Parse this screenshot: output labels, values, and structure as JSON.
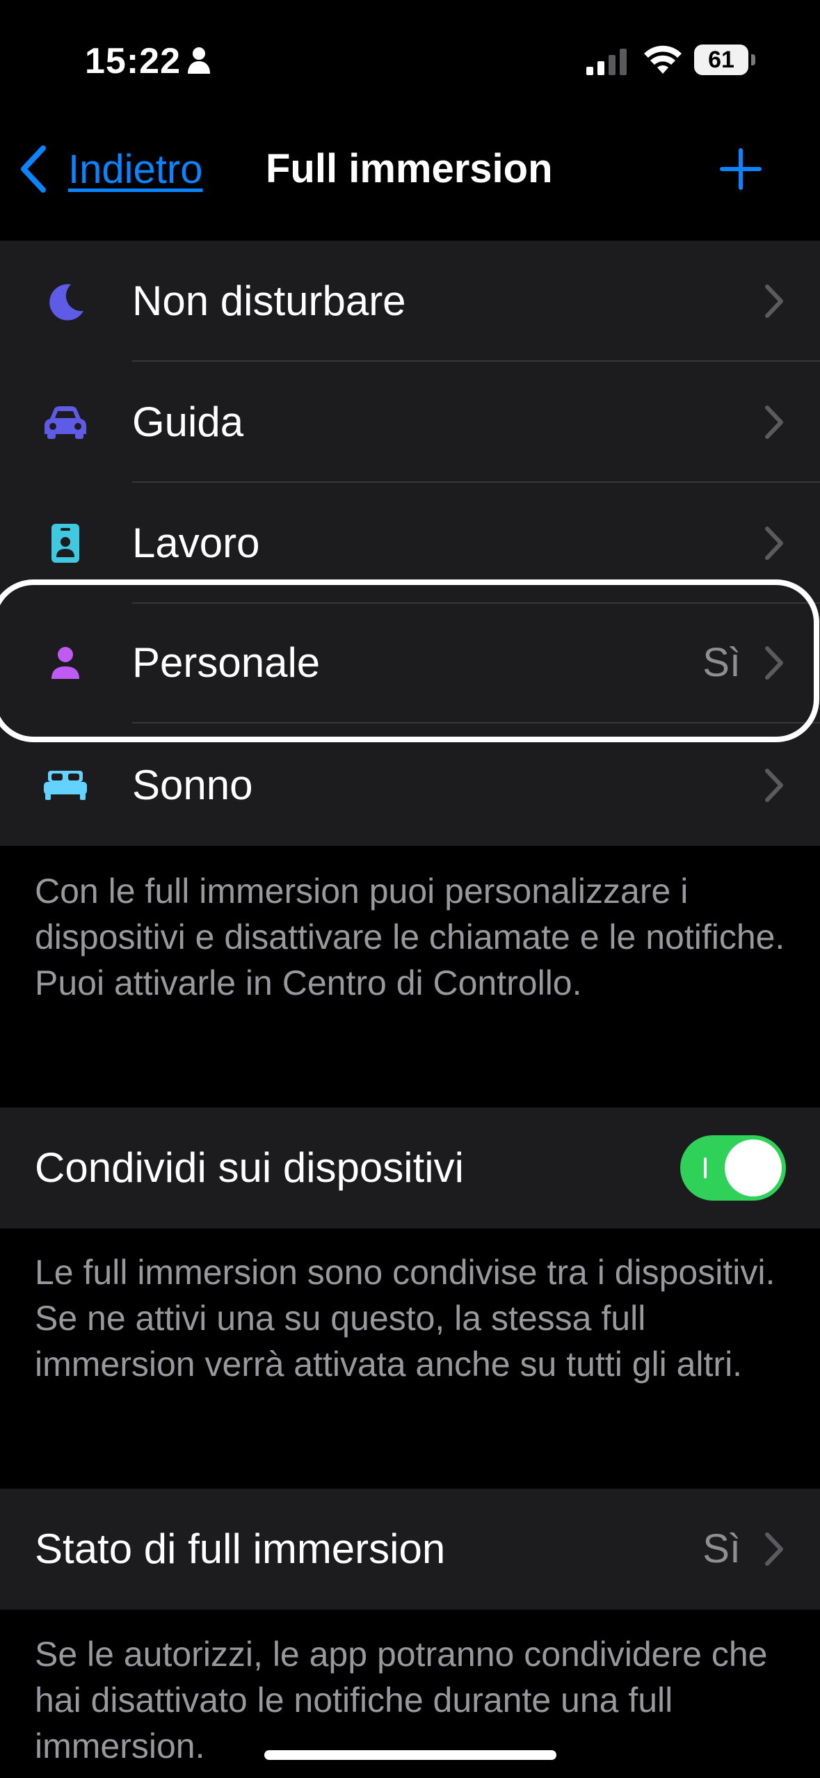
{
  "status_bar": {
    "time": "15:22",
    "battery": "61"
  },
  "nav": {
    "back_label": "Indietro",
    "title": "Full immersion"
  },
  "focus_modes": [
    {
      "label": "Non disturbare",
      "icon": "moon-icon",
      "color": "#5e5ce6",
      "value": ""
    },
    {
      "label": "Guida",
      "icon": "car-icon",
      "color": "#5e5ce6",
      "value": ""
    },
    {
      "label": "Lavoro",
      "icon": "id-badge-icon",
      "color": "#40c8e0",
      "value": ""
    },
    {
      "label": "Personale",
      "icon": "person-icon",
      "color": "#bf5af2",
      "value": "Sì"
    },
    {
      "label": "Sonno",
      "icon": "bed-icon",
      "color": "#64d2ff",
      "value": ""
    }
  ],
  "notes": {
    "focus_info": "Con le full immersion puoi personalizzare i dispositivi e disattivare le chiamate e le notifiche. Puoi attivarle in Centro di Controllo.",
    "share_info": "Le full immersion sono condivise tra i dispositivi. Se ne attivi una su questo, la stessa full immersion verrà attivata anche su tutti gli altri.",
    "status_info": "Se le autorizzi, le app potranno condividere che hai disattivato le notifiche durante una full immersion."
  },
  "share_across_devices": {
    "label": "Condividi sui dispositivi",
    "enabled": true
  },
  "focus_status": {
    "label": "Stato di full immersion",
    "value": "Sì"
  },
  "colors": {
    "accent": "#0a84ff",
    "toggle_on": "#30d158",
    "group_bg": "#1c1c1e",
    "secondary_text": "#98989d"
  }
}
